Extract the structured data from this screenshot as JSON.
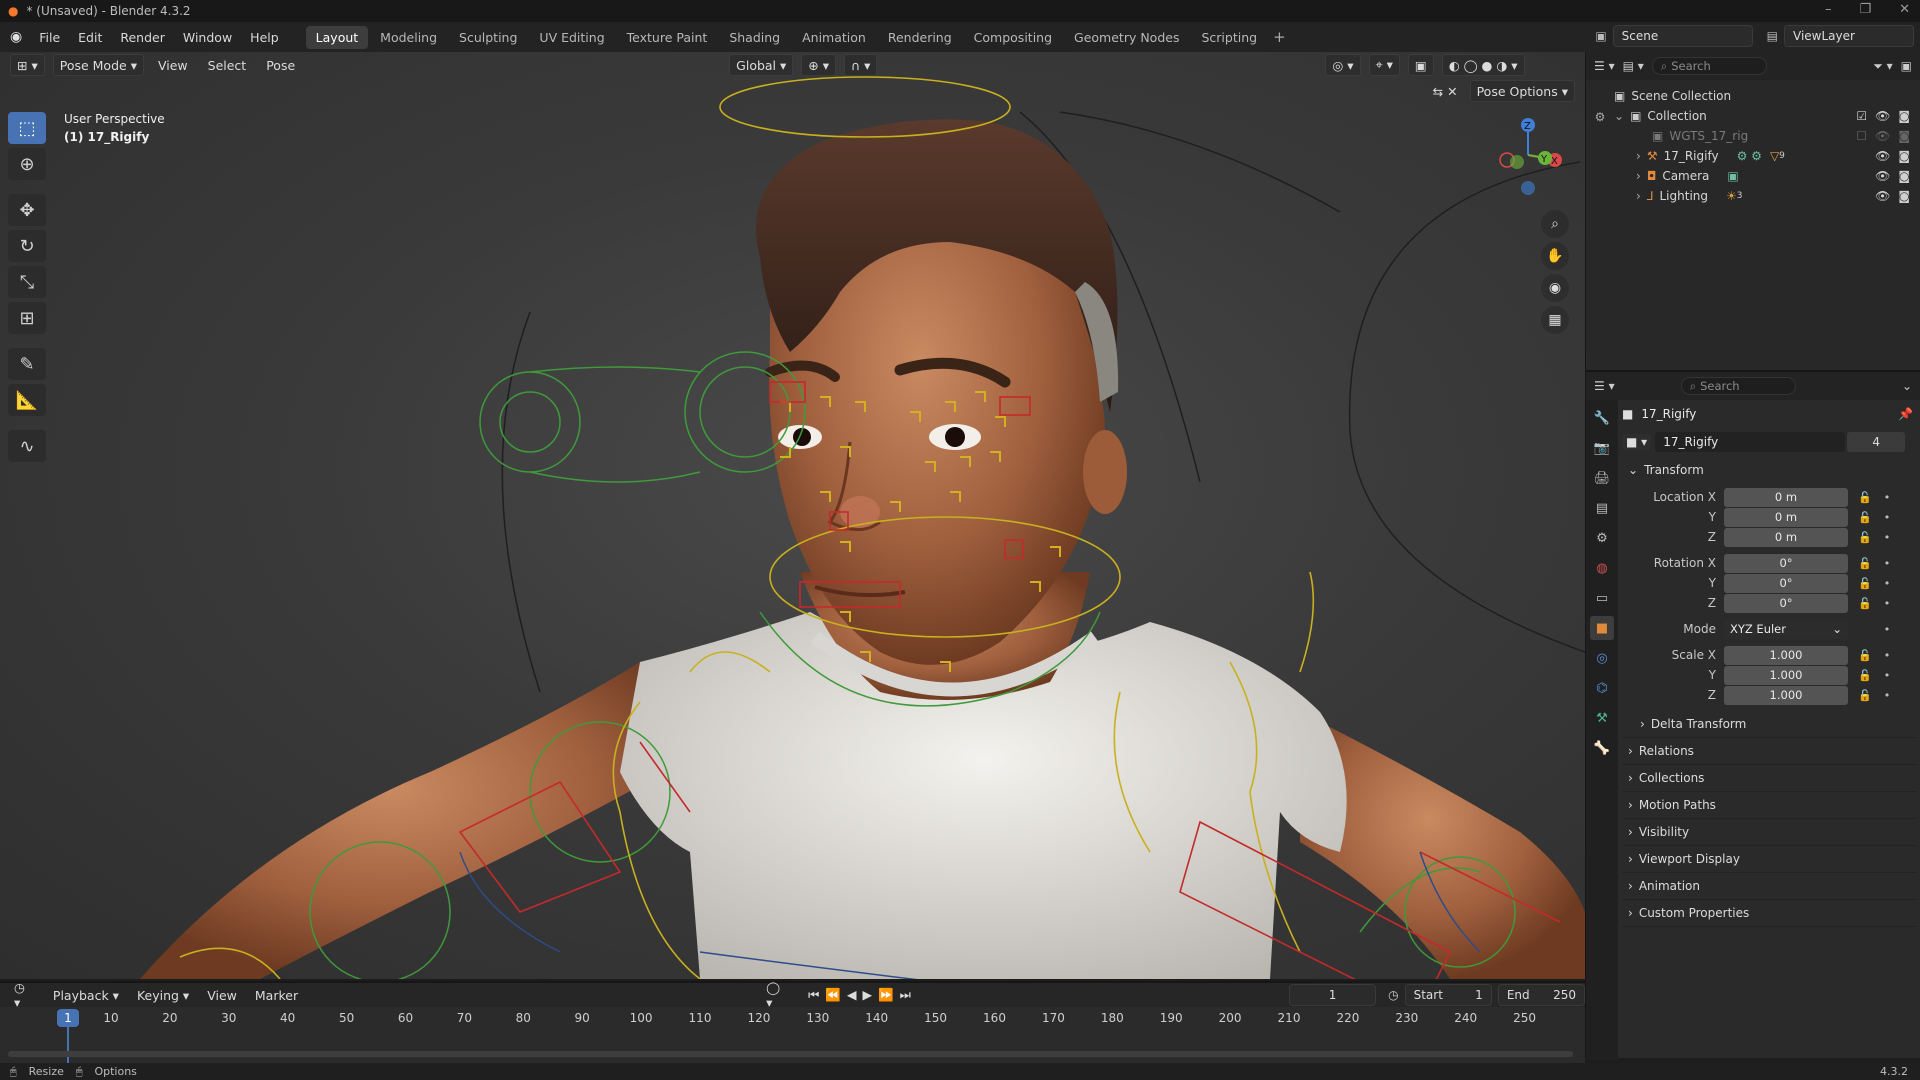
{
  "window": {
    "title": "* (Unsaved) - Blender 4.3.2",
    "buttons": [
      "–",
      "❐",
      "✕"
    ]
  },
  "menu": [
    "File",
    "Edit",
    "Render",
    "Window",
    "Help"
  ],
  "workspaces": {
    "tabs": [
      "Layout",
      "Modeling",
      "Sculpting",
      "UV Editing",
      "Texture Paint",
      "Shading",
      "Animation",
      "Rendering",
      "Compositing",
      "Geometry Nodes",
      "Scripting"
    ],
    "active": "Layout"
  },
  "scene": {
    "name": "Scene",
    "view_layer": "ViewLayer"
  },
  "viewport": {
    "mode": "Pose Mode",
    "menus": [
      "View",
      "Select",
      "Pose"
    ],
    "transform_orientation": "Global",
    "options_label": "Pose Options",
    "info_line1": "User Perspective",
    "info_line2": "(1) 17_Rigify",
    "gizmo_axes": {
      "x": "X",
      "y": "Y",
      "z": "Z"
    }
  },
  "tools": [
    "select-box",
    "cursor",
    "move",
    "rotate",
    "scale",
    "transform",
    "annotate",
    "measure",
    "relax"
  ],
  "outliner": {
    "search_placeholder": "Search",
    "rows": [
      {
        "label": "Scene Collection"
      },
      {
        "label": "Collection"
      },
      {
        "label": "WGTS_17_rig"
      },
      {
        "label": "17_Rigify",
        "badge": "9"
      },
      {
        "label": "Camera"
      },
      {
        "label": "Lighting",
        "badge": "3"
      }
    ]
  },
  "properties": {
    "search_placeholder": "Search",
    "object_name": "17_Rigify",
    "data_name": "17_Rigify",
    "users": "4",
    "transform_label": "Transform",
    "location_label": "Location X",
    "rotation_label": "Rotation X",
    "scale_label": "Scale X",
    "mode_label": "Mode",
    "axis_y": "Y",
    "axis_z": "Z",
    "location": {
      "x": "0 m",
      "y": "0 m",
      "z": "0 m"
    },
    "rotation": {
      "x": "0°",
      "y": "0°",
      "z": "0°"
    },
    "rotation_mode": "XYZ Euler",
    "scale": {
      "x": "1.000",
      "y": "1.000",
      "z": "1.000"
    },
    "delta_transform": "Delta Transform",
    "sections": [
      "Relations",
      "Collections",
      "Motion Paths",
      "Visibility",
      "Viewport Display",
      "Animation",
      "Custom Properties"
    ]
  },
  "timeline": {
    "menus": [
      "Playback",
      "Keying",
      "View",
      "Marker"
    ],
    "current_frame": "1",
    "start_label": "Start",
    "start": "1",
    "end_label": "End",
    "end": "250",
    "ticks": [
      "10",
      "20",
      "30",
      "40",
      "50",
      "60",
      "70",
      "80",
      "90",
      "100",
      "110",
      "120",
      "130",
      "140",
      "150",
      "160",
      "170",
      "180",
      "190",
      "200",
      "210",
      "220",
      "230",
      "240",
      "250"
    ]
  },
  "status": {
    "left1": "Resize",
    "left2": "Options",
    "version": "4.3.2"
  }
}
